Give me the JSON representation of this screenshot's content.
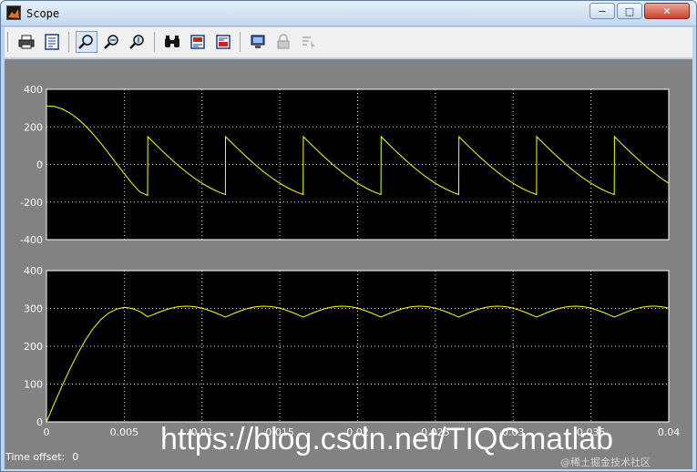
{
  "window": {
    "title": "Scope",
    "minimize_glyph": "−",
    "maximize_glyph": "□",
    "close_glyph": "✕"
  },
  "toolbar": {
    "buttons": [
      {
        "icon": "print-icon"
      },
      {
        "icon": "parameters-icon"
      },
      {
        "icon": "zoom-icon",
        "pressed": true
      },
      {
        "icon": "zoom-x-icon"
      },
      {
        "icon": "zoom-y-icon"
      },
      {
        "icon": "autoscale-icon"
      },
      {
        "icon": "save-axes-icon"
      },
      {
        "icon": "restore-axes-icon"
      },
      {
        "icon": "floating-scope-icon"
      },
      {
        "icon": "lock-axes-icon"
      },
      {
        "icon": "signal-selector-icon"
      }
    ]
  },
  "colors": {
    "plot_background": "#828282",
    "axes_background": "#000000",
    "trace": "#ffff00",
    "grid": "#ffffff"
  },
  "footer": {
    "time_offset_label": "Time offset:",
    "time_offset_value": "0"
  },
  "watermark": {
    "text": "https://blog.csdn.net/TIQCmatlab",
    "sub": "@稀土掘金技术社区"
  },
  "chart_data": [
    {
      "type": "line",
      "x_range": [
        0,
        0.04
      ],
      "ylim": [
        -400,
        400
      ],
      "yticks": [
        "400",
        "200",
        "0",
        "-200",
        "-400"
      ],
      "xticks": [
        "0",
        "0.005",
        "0.01",
        "0.015",
        "0.02",
        "0.025",
        "0.03",
        "0.035",
        "0.04"
      ],
      "show_xtick_labels": false,
      "grid": true,
      "series": [
        {
          "x": [
            0,
            0.0005,
            0.001,
            0.0015,
            0.002,
            0.0025,
            0.003,
            0.0035,
            0.004,
            0.0045,
            0.005,
            0.0055,
            0.006,
            0.0065,
            0.00651,
            0.0115,
            0.01151,
            0.0165,
            0.01651,
            0.0215,
            0.02151,
            0.0265,
            0.02651,
            0.0315,
            0.03151,
            0.0365,
            0.03651,
            0.0401
          ],
          "y": [
            311,
            309,
            296,
            274,
            244,
            206,
            162,
            112,
            59,
            5,
            -49,
            -101,
            -146,
            -165,
            148,
            -160,
            148,
            -160,
            148,
            -160,
            148,
            -160,
            148,
            -160,
            148,
            -160,
            148,
            -155
          ],
          "note_subcycle": true
        }
      ]
    },
    {
      "type": "line",
      "x_range": [
        0,
        0.04
      ],
      "ylim": [
        0,
        400
      ],
      "yticks": [
        "400",
        "300",
        "200",
        "100",
        "0"
      ],
      "xticks": [
        "0",
        "0.005",
        "0.01",
        "0.015",
        "0.02",
        "0.025",
        "0.03",
        "0.035",
        "0.04"
      ],
      "xlabel": "",
      "grid": true,
      "series": [
        {
          "x": [
            0,
            0.0005,
            0.001,
            0.0015,
            0.002,
            0.0025,
            0.003,
            0.0035,
            0.004,
            0.0045,
            0.005,
            0.0055,
            0.006,
            0.0065
          ],
          "y": [
            0,
            48,
            95,
            139,
            180,
            216,
            247,
            271,
            288,
            298,
            303,
            300,
            292,
            278
          ],
          "ripple": {
            "start": 0.0065,
            "end": 0.04,
            "period": 0.005,
            "min": 277,
            "max": 306
          }
        }
      ]
    }
  ]
}
